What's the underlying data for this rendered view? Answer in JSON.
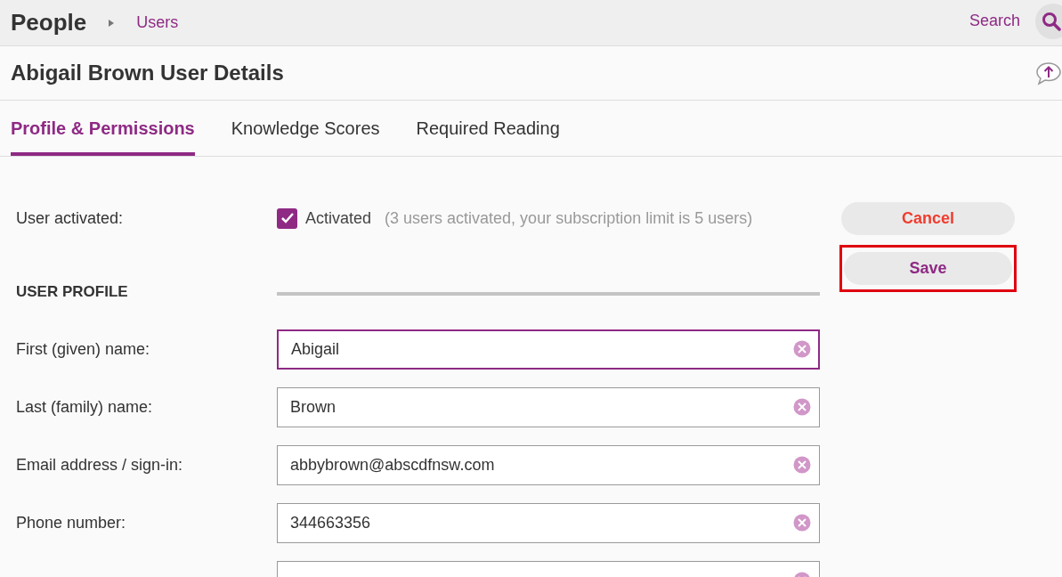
{
  "header": {
    "title": "People",
    "breadcrumb": "Users",
    "search_label": "Search"
  },
  "page_title": "Abigail Brown User Details",
  "tabs": [
    {
      "label": "Profile & Permissions",
      "selected": true
    },
    {
      "label": "Knowledge Scores",
      "selected": false
    },
    {
      "label": "Required Reading",
      "selected": false
    }
  ],
  "activation": {
    "label": "User activated:",
    "checked": true,
    "checkbox_label": "Activated",
    "note": "(3 users activated, your subscription limit is 5 users)"
  },
  "section_heading": "USER PROFILE",
  "fields": [
    {
      "label": "First (given) name:",
      "value": "Abigail",
      "focused": true
    },
    {
      "label": "Last (family) name:",
      "value": "Brown",
      "focused": false
    },
    {
      "label": "Email address / sign-in:",
      "value": "abbybrown@abscdfnsw.com",
      "focused": false
    },
    {
      "label": "Phone number:",
      "value": "344663356",
      "focused": false
    },
    {
      "kind": "cut_off",
      "focused": false
    }
  ],
  "buttons": [
    {
      "label": "Cancel",
      "kind": "cancel",
      "highlighted": false
    },
    {
      "label": "Save",
      "kind": "save",
      "highlighted": true
    }
  ]
}
